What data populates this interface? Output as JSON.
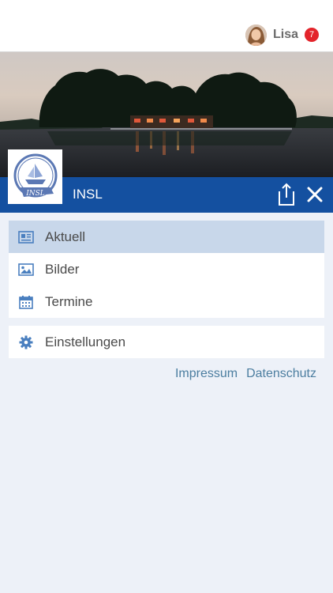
{
  "user": {
    "name": "Lisa",
    "notification_count": "7"
  },
  "header": {
    "title": "INSL"
  },
  "menu": {
    "items": [
      {
        "label": "Aktuell",
        "icon": "newspaper-icon",
        "active": true
      },
      {
        "label": "Bilder",
        "icon": "image-icon",
        "active": false
      },
      {
        "label": "Termine",
        "icon": "calendar-icon",
        "active": false
      }
    ]
  },
  "settings": {
    "label": "Einstellungen",
    "icon": "gear-icon"
  },
  "footer": {
    "impressum": "Impressum",
    "datenschutz": "Datenschutz"
  },
  "colors": {
    "header_blue": "#1450a0",
    "active_item": "#c8d7ea",
    "icon_blue": "#4a7fbf",
    "link": "#4c7ea0",
    "badge_red": "#e3242b",
    "background": "#edf1f8"
  }
}
